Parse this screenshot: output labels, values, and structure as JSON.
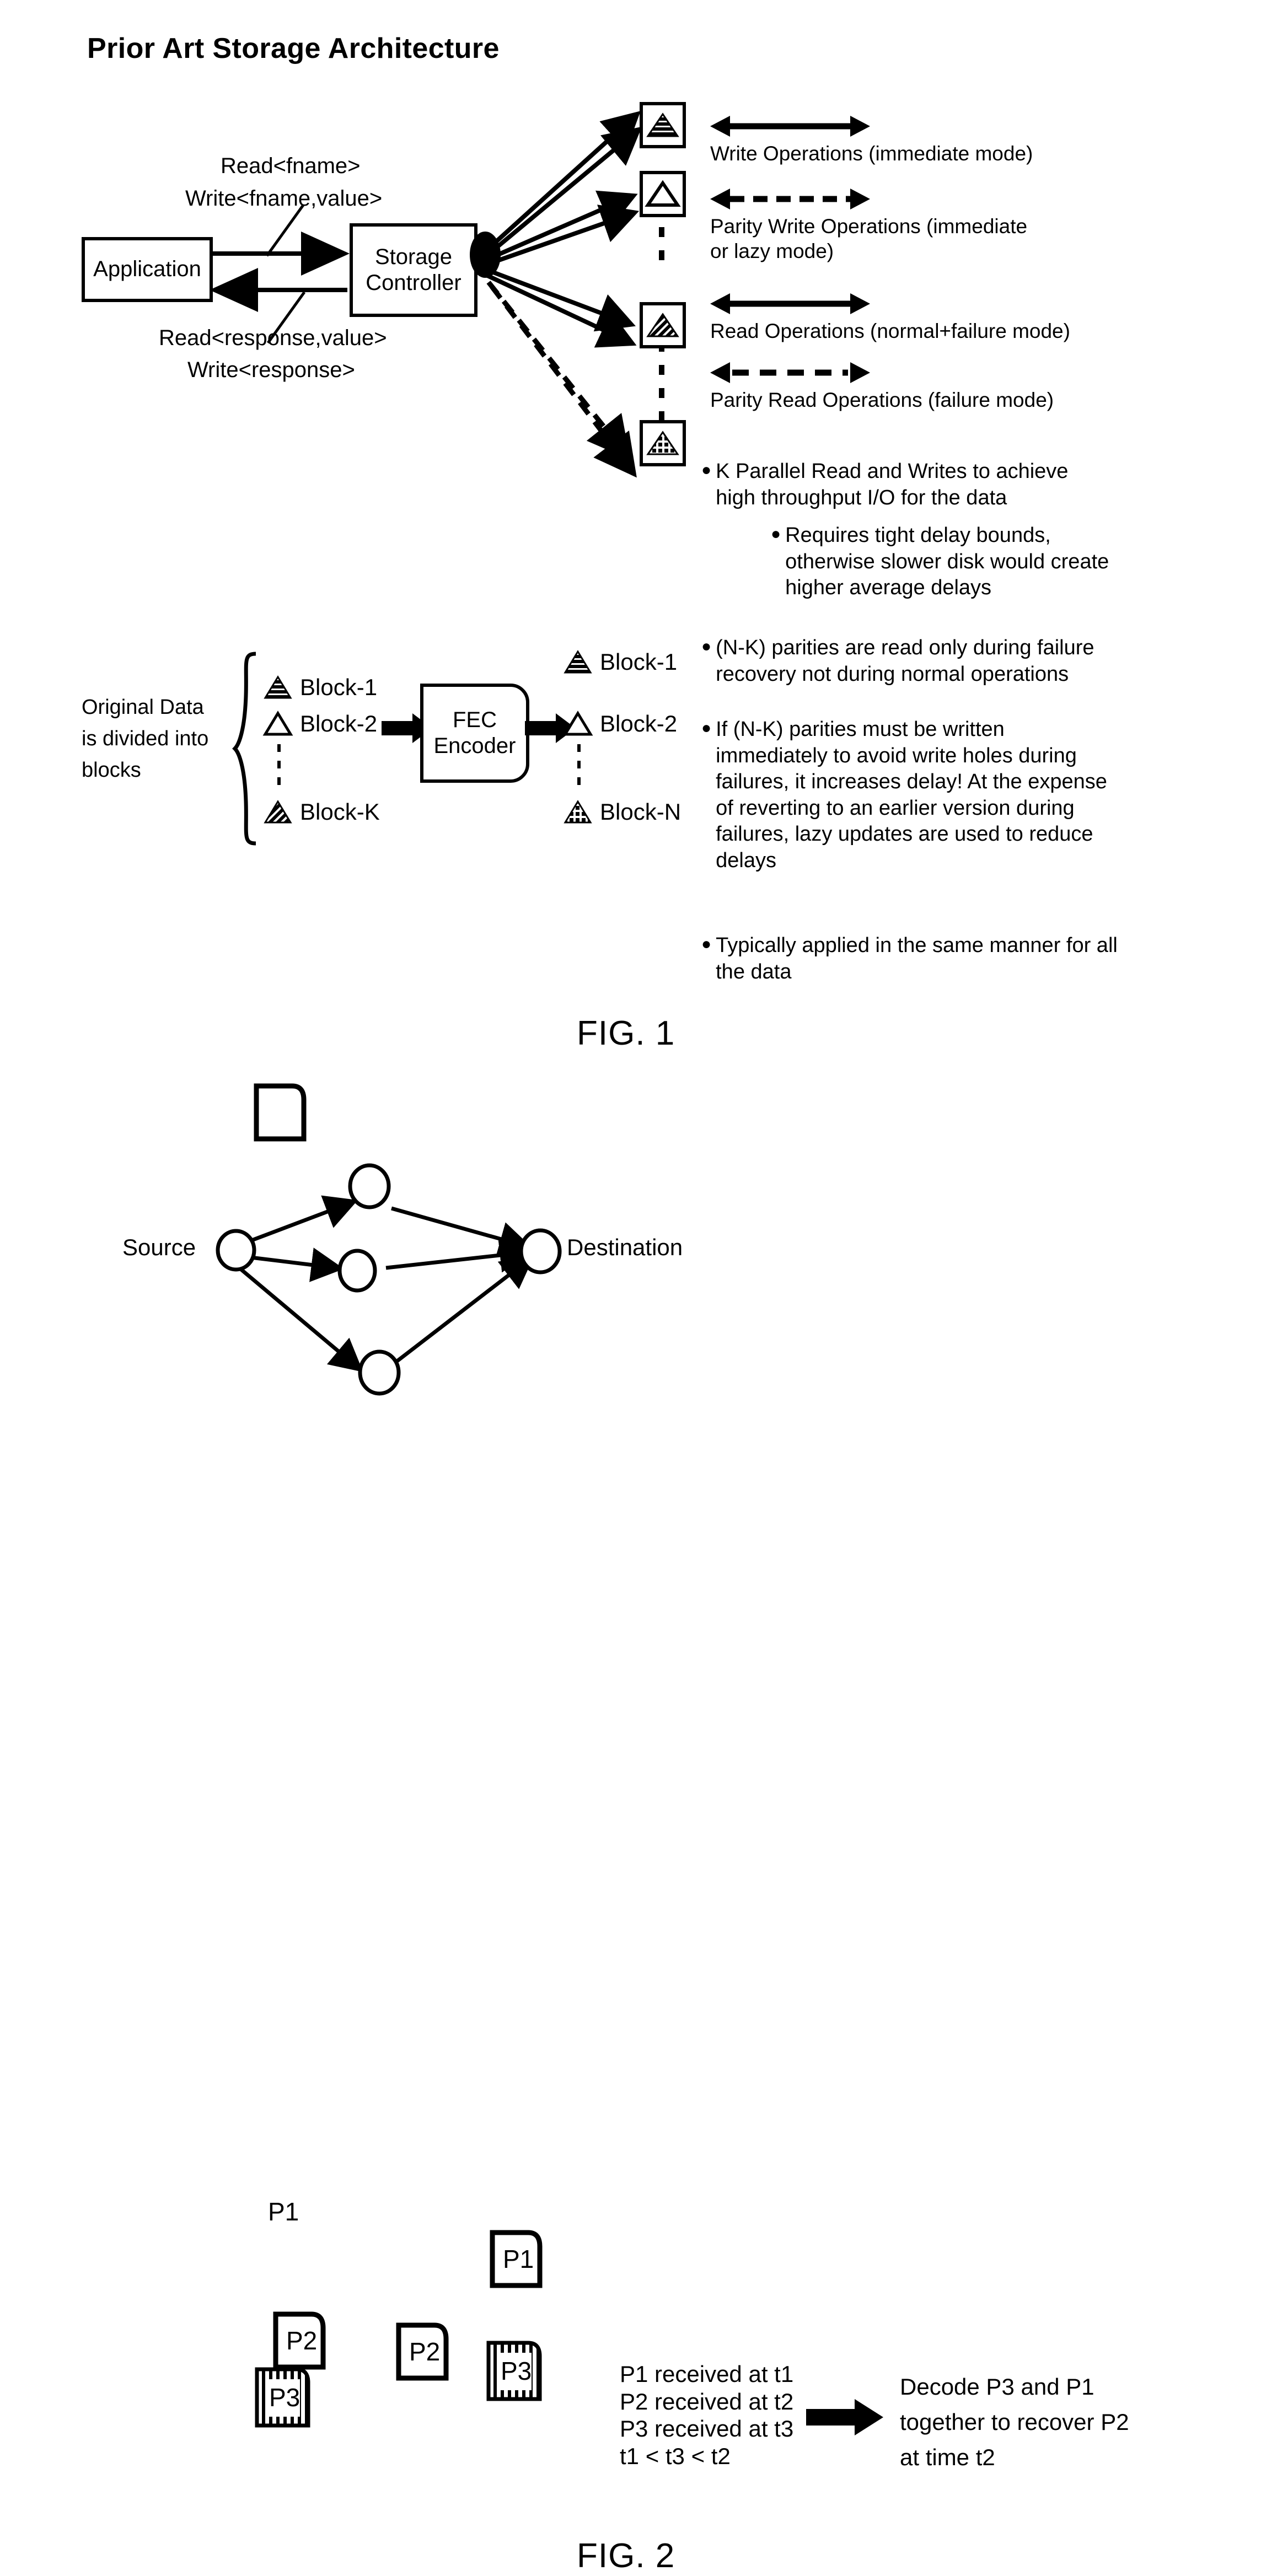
{
  "title": "Prior Art Storage Architecture",
  "fig1": {
    "label": "FIG. 1",
    "application_box": "Application",
    "controller_box": "Storage\nController",
    "request_label_line1": "Read<fname>",
    "request_label_line2": "Write<fname,value>",
    "response_label_line1": "Read<response,value>",
    "response_label_line2": "Write<response>",
    "legend": [
      {
        "arrow": "solid-double-arrow",
        "text": "Write Operations (immediate mode)"
      },
      {
        "arrow": "dashed-double-arrow",
        "text": "Parity Write Operations (immediate\nor lazy mode)"
      },
      {
        "arrow": "solid-double-arrow",
        "text": "Read Operations (normal+failure mode)"
      },
      {
        "arrow": "dashed-double-arrow",
        "text": "Parity Read Operations (failure mode)"
      }
    ],
    "bullets": [
      {
        "level": 1,
        "text": "K Parallel Read and Writes to achieve high throughput I/O for the data"
      },
      {
        "level": 2,
        "text": "Requires tight delay bounds, otherwise slower disk would create higher average delays"
      },
      {
        "level": 1,
        "text": "(N-K) parities are read only during failure recovery not during normal operations"
      },
      {
        "level": 1,
        "text": "If (N-K) parities must be written immediately to avoid write holes during failures, it increases delay! At the expense of reverting to an earlier version during failures, lazy updates are used to reduce delays"
      },
      {
        "level": 1,
        "text": "Typically applied in the same manner for all the data"
      }
    ],
    "fec": {
      "caption": "Original Data\nis divided into\nblocks",
      "encoder_line1": "FEC",
      "encoder_line2": "Encoder",
      "input_blocks": [
        {
          "label": "Block-1",
          "pattern": "horizontal-stripes"
        },
        {
          "label": "Block-2",
          "pattern": "outline"
        },
        {
          "label": "Block-K",
          "pattern": "diagonal-stripes"
        }
      ],
      "output_blocks": [
        {
          "label": "Block-1",
          "pattern": "horizontal-stripes"
        },
        {
          "label": "Block-2",
          "pattern": "outline"
        },
        {
          "label": "Block-N",
          "pattern": "crosshatch"
        }
      ]
    },
    "disk_icons": [
      {
        "pattern": "horizontal-stripes"
      },
      {
        "pattern": "outline"
      },
      {
        "pattern": "diagonal-stripes"
      },
      {
        "pattern": "crosshatch"
      }
    ]
  },
  "fig2": {
    "label": "FIG. 2",
    "source_label": "Source",
    "destination_label": "Destination",
    "packets": [
      {
        "name": "P1",
        "style": "plain"
      },
      {
        "name": "P1",
        "style": "plain"
      },
      {
        "name": "P2",
        "style": "plain"
      },
      {
        "name": "P2",
        "style": "plain"
      },
      {
        "name": "P3",
        "style": "hatched"
      },
      {
        "name": "P3",
        "style": "hatched"
      }
    ],
    "timing_lines": [
      "P1 received at t1",
      "P2 received at t2",
      "P3 received at t3",
      "t1 < t3 < t2"
    ],
    "conclusion": "Decode P3 and P1\ntogether to recover P2\nat time t2"
  }
}
